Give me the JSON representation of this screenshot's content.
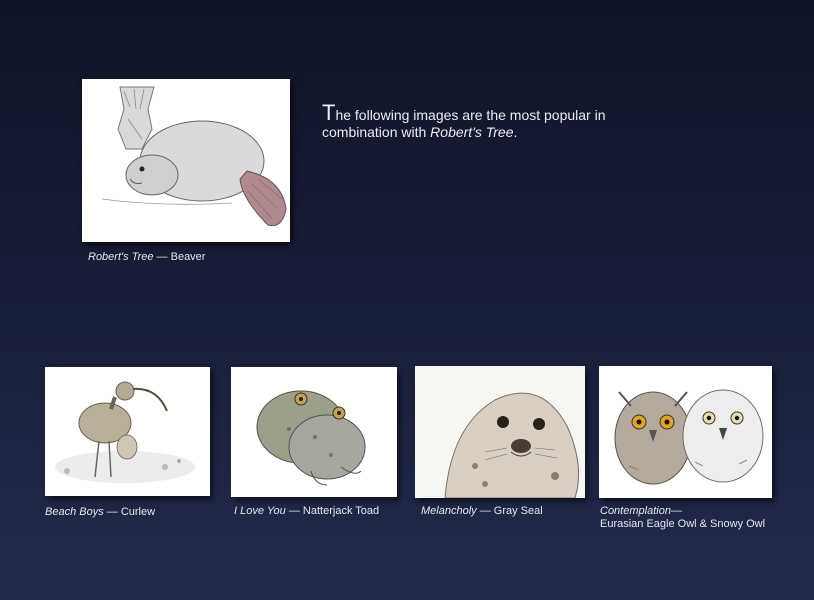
{
  "intro": {
    "dropcap": "T",
    "text_before": "he following images are the most popular in combination with ",
    "featured_title": "Robert's Tree",
    "text_after": "."
  },
  "featured": {
    "title": "Robert's Tree",
    "separator": " — ",
    "subject": "Beaver"
  },
  "gallery": [
    {
      "title": "Beach Boys",
      "separator": " — ",
      "subject": "Curlew"
    },
    {
      "title": "I Love You",
      "separator": " — ",
      "subject": "Natterjack Toad"
    },
    {
      "title": "Melancholy",
      "separator": " — ",
      "subject": "Gray Seal"
    },
    {
      "title": "Contemplation",
      "separator": "—",
      "subject": "Eurasian Eagle Owl & Snowy Owl"
    }
  ],
  "colors": {
    "background_top": "#0f1426",
    "background_bottom": "#222b4d",
    "caption_text": "#e4e6ee",
    "thumbnail_bg": "#ffffff"
  }
}
